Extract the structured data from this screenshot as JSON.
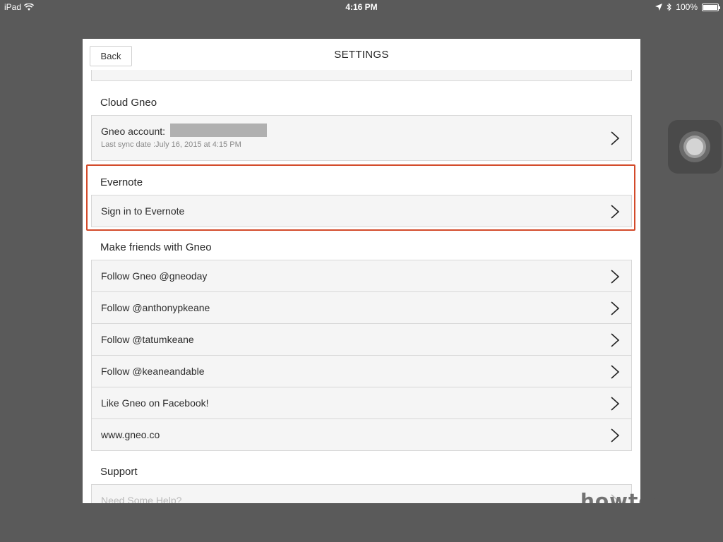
{
  "status_bar": {
    "device": "iPad",
    "time": "4:16 PM",
    "battery": "100%"
  },
  "header": {
    "back_label": "Back",
    "title": "SETTINGS"
  },
  "cloud": {
    "section_title": "Cloud Gneo",
    "account_label": "Gneo account:",
    "sync_text": "Last sync date :July 16, 2015 at 4:15 PM"
  },
  "evernote": {
    "section_title": "Evernote",
    "sign_in_label": "Sign in to Evernote"
  },
  "friends": {
    "section_title": "Make friends with Gneo",
    "items": [
      {
        "label": "Follow Gneo @gneoday"
      },
      {
        "label": "Follow @anthonypkeane"
      },
      {
        "label": "Follow @tatumkeane"
      },
      {
        "label": "Follow @keaneandable"
      },
      {
        "label": "Like Gneo on Facebook!"
      },
      {
        "label": "www.gneo.co"
      }
    ]
  },
  "support": {
    "section_title": "Support",
    "items": [
      {
        "label": "Need Some Help?"
      }
    ]
  },
  "watermark": "howtos.tw",
  "colors": {
    "highlight": "#d34a2a",
    "row_bg": "#f5f5f5",
    "overlay_bg": "#5a5a5a"
  },
  "icons": {
    "chevron": "chevron-right-icon",
    "wifi": "wifi-icon",
    "location": "location-arrow-icon",
    "bluetooth": "bluetooth-icon",
    "battery": "battery-icon",
    "assistive_touch": "assistive-touch-icon"
  }
}
